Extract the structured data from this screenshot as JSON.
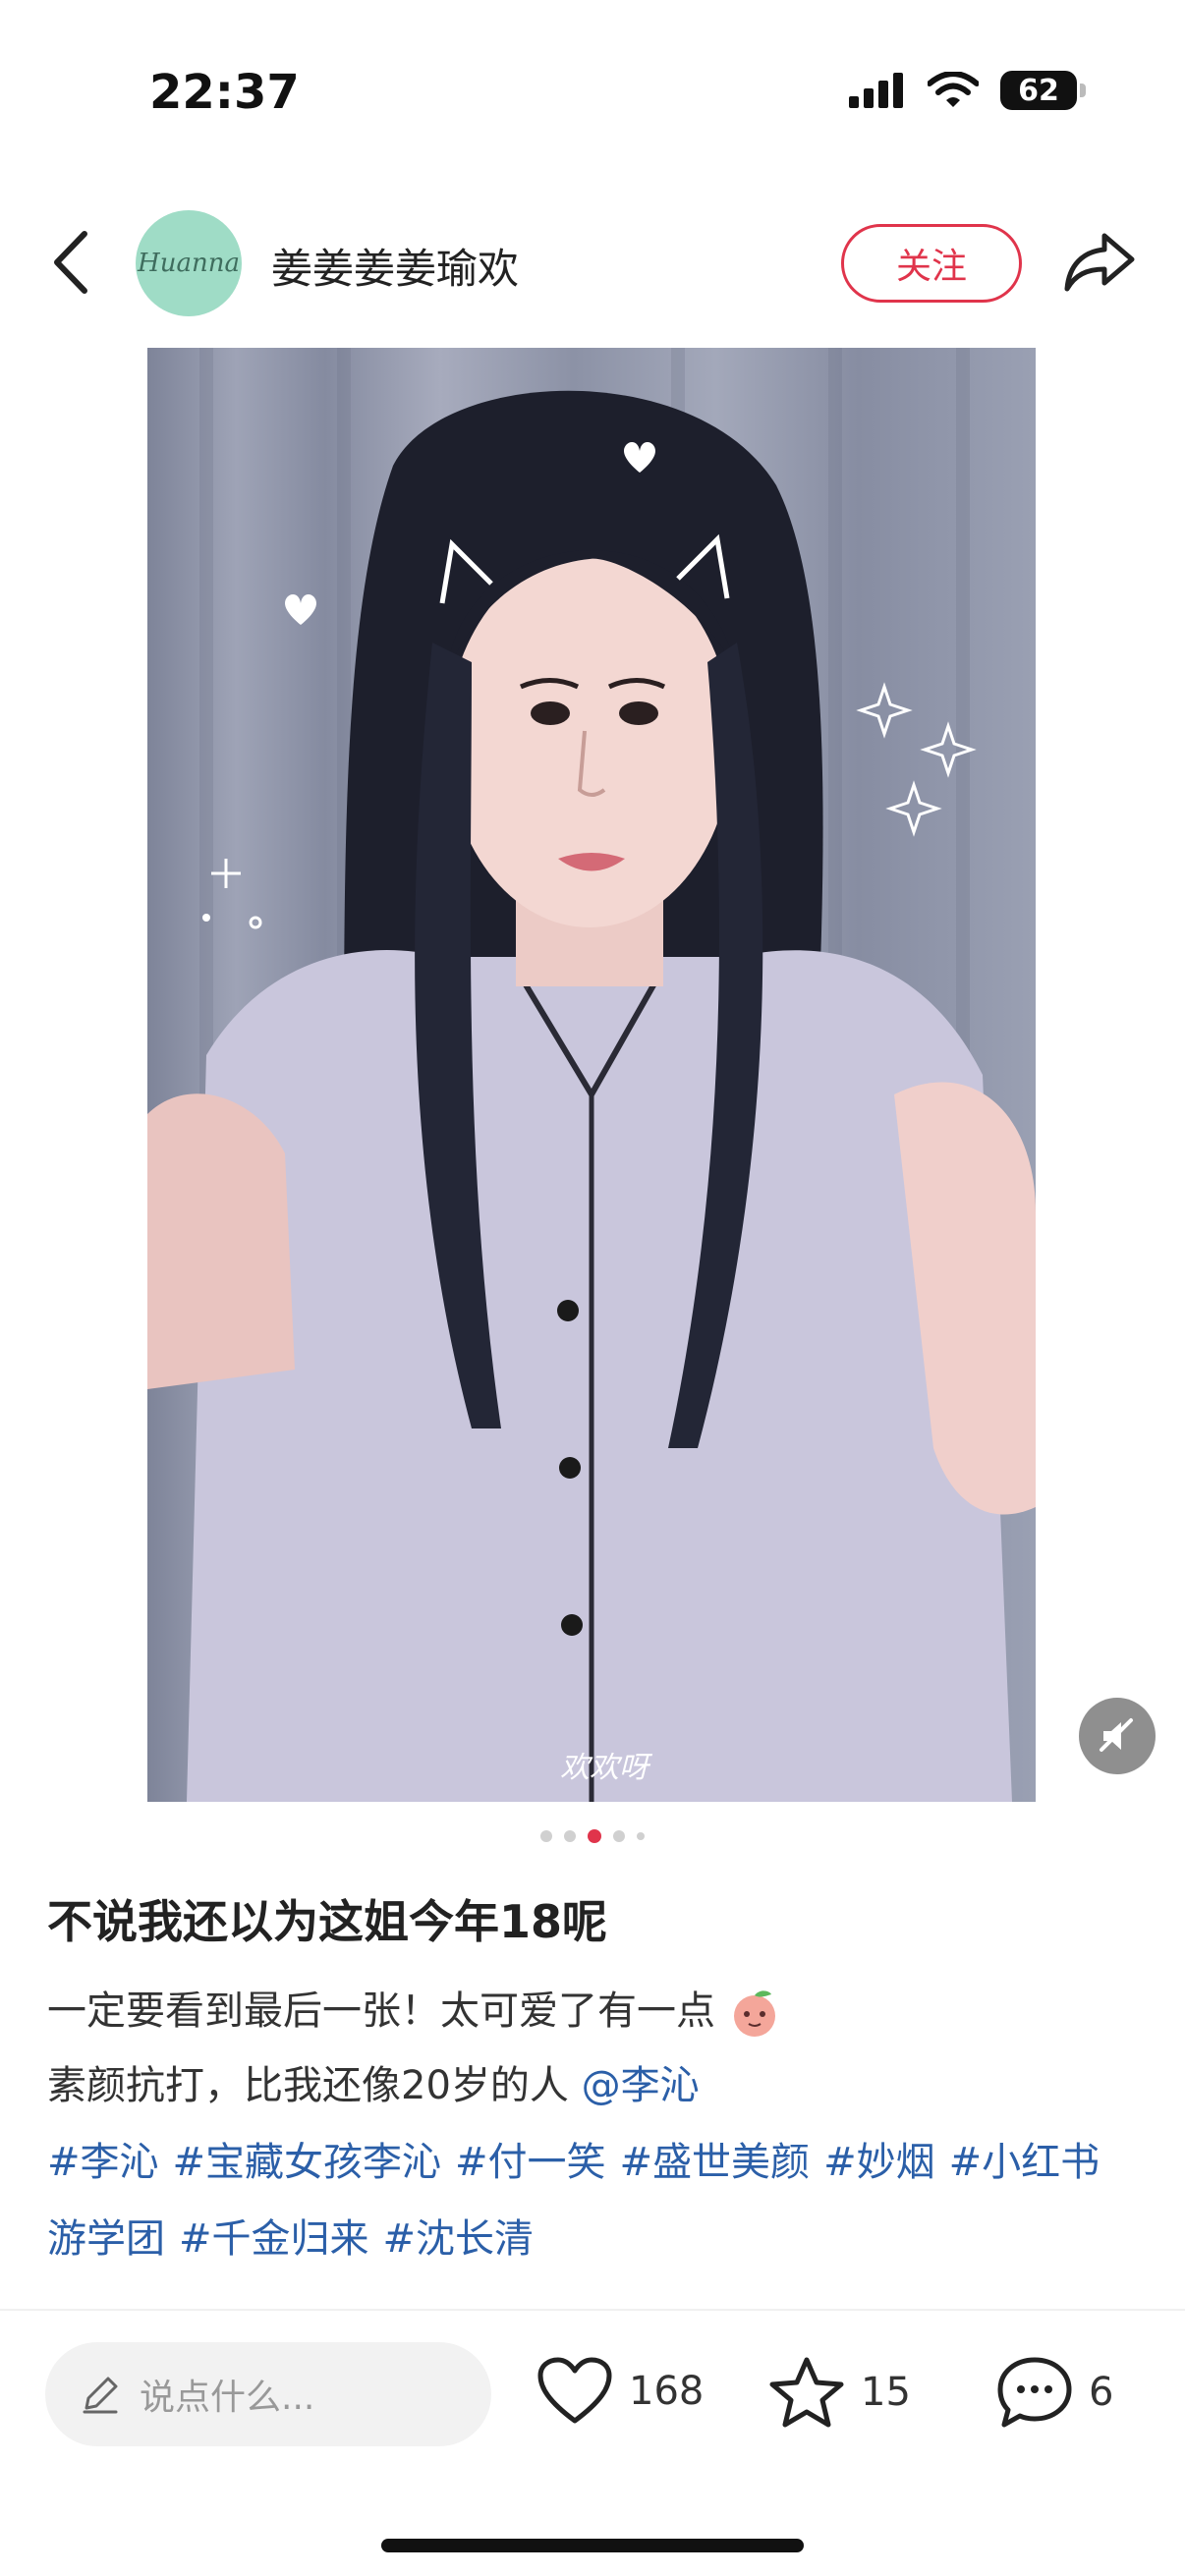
{
  "status_bar": {
    "time": "22:37",
    "battery": "62"
  },
  "header": {
    "avatar_text": "Huanna",
    "username": "姜姜姜姜瑜欢",
    "follow_label": "关注"
  },
  "carousel": {
    "total": 5,
    "active_index": 2
  },
  "watermark": "欢欢呀",
  "post": {
    "title": "不说我还以为这姐今年18呢",
    "line1": "一定要看到最后一张！太可爱了有一点",
    "line2_text": "素颜抗打，比我还像20岁的人 ",
    "mention": "@李沁",
    "tags": [
      "#李沁",
      "#宝藏女孩李沁",
      "#付一笑",
      "#盛世美颜",
      "#妙烟",
      "#小红书游学团",
      "#千金归来",
      "#沈长清"
    ]
  },
  "bottom_bar": {
    "comment_placeholder": "说点什么...",
    "likes": "168",
    "stars": "15",
    "comments": "6"
  },
  "colors": {
    "accent": "#e0344b",
    "link": "#2b5fa8"
  }
}
